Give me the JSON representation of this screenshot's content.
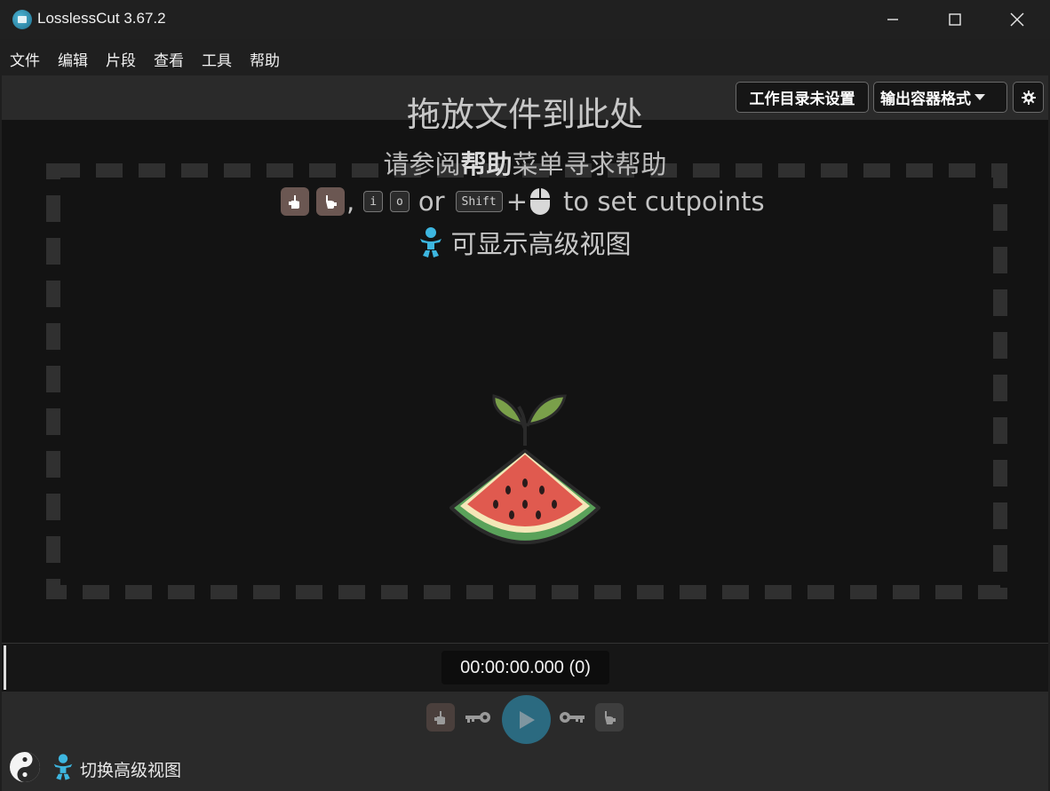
{
  "window": {
    "title": "LosslessCut 3.67.2",
    "controls": [
      "minimize-icon",
      "maximize-icon",
      "close-icon"
    ]
  },
  "menu": {
    "items": [
      "文件",
      "编辑",
      "片段",
      "查看",
      "工具",
      "帮助"
    ]
  },
  "toolbar": {
    "workdir_label": "工作目录未设置",
    "format_label": "输出容器格式",
    "settings_icon": "gear-icon"
  },
  "drop_area": {
    "title": "拖放文件到此处",
    "help_prefix": "请参阅",
    "help_bold": "帮助",
    "help_suffix": "菜单寻求帮助",
    "key_i": "i",
    "key_o": "o",
    "or_text": "or",
    "key_shift": "Shift",
    "plus_text": "+",
    "cutpoints_text": "to set cutpoints",
    "advanced_text": "可显示高级视图"
  },
  "timeline": {
    "timecode": "00:00:00.000 (0)"
  },
  "bottom": {
    "toggle_label": "切换高级视图"
  },
  "colors": {
    "accent_play": "#2b6a80",
    "baby_icon": "#3db6e0",
    "watermelon_red": "#e05a4f",
    "watermelon_green": "#5aa25a"
  }
}
